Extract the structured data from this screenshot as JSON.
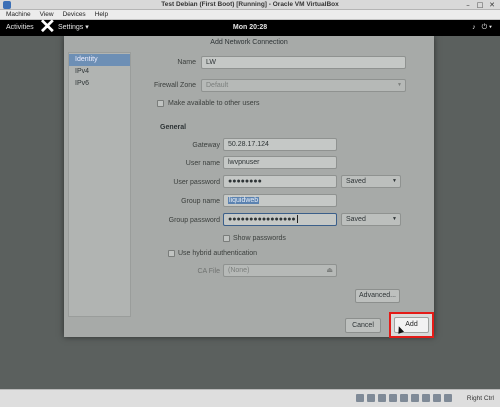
{
  "window": {
    "title": "Test Debian (First Boot) [Running] - Oracle VM VirtualBox",
    "controls": [
      "–",
      "□",
      "✕"
    ]
  },
  "menubar": [
    "Machine",
    "View",
    "Devices",
    "Help"
  ],
  "gnome": {
    "activities": "Activities",
    "app_menu": "Settings ▾",
    "clock": "Mon 20:28",
    "tray": [
      "♪",
      "⏻ ▾"
    ]
  },
  "dialog": {
    "title": "Add Network Connection",
    "sidebar": [
      {
        "label": "Identity",
        "selected": true
      },
      {
        "label": "IPv4",
        "selected": false
      },
      {
        "label": "IPv6",
        "selected": false
      }
    ],
    "name_label": "Name",
    "name_value": "LW",
    "firewall_label": "Firewall Zone",
    "firewall_value": "Default",
    "available_label": "Make available to other users",
    "general_header": "General",
    "gateway_label": "Gateway",
    "gateway_value": "50.28.17.124",
    "username_label": "User name",
    "username_value": "lwvpnuser",
    "userpass_label": "User password",
    "userpass_value": "●●●●●●●●",
    "userpass_store": "Saved",
    "groupname_label": "Group name",
    "groupname_value": "liquidweb",
    "grouppass_label": "Group password",
    "grouppass_value": "●●●●●●●●●●●●●●●●",
    "grouppass_store": "Saved",
    "show_passwords_label": "Show passwords",
    "hybrid_label": "Use hybrid authentication",
    "cafile_label": "CA File",
    "cafile_value": "(None)",
    "advanced_button": "Advanced...",
    "cancel_button": "Cancel",
    "add_button": "Add"
  },
  "status": {
    "host_key": "Right Ctrl"
  },
  "colors": {
    "highlight": "#e41b17",
    "selection": "#5b82b0"
  }
}
